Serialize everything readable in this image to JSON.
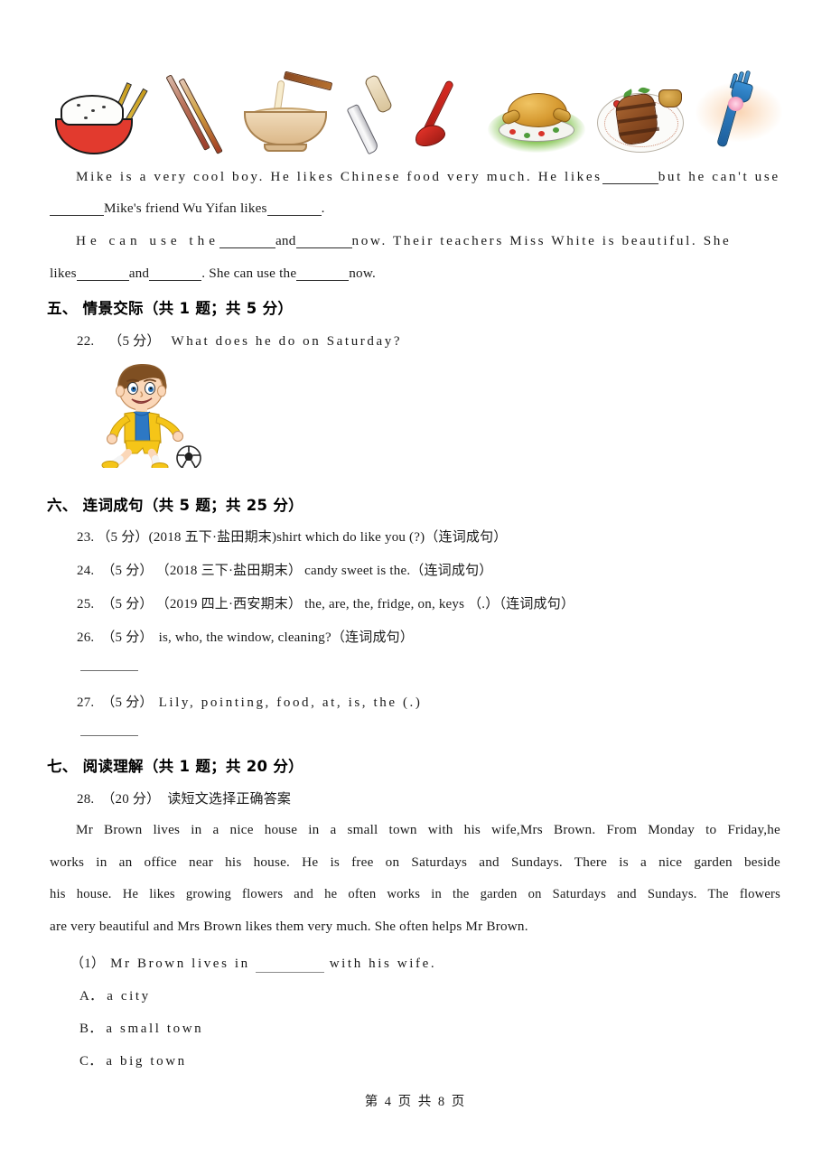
{
  "document": {
    "page_footer": "第 4 页 共 8 页",
    "page_number": 4,
    "total_pages": 8
  },
  "top_images": [
    {
      "name": "rice-bowl-with-chopsticks",
      "label": "rice bowl with chopsticks"
    },
    {
      "name": "chopsticks",
      "label": "chopsticks"
    },
    {
      "name": "noodle-bowl",
      "label": "noodle bowl with chopsticks"
    },
    {
      "name": "knife",
      "label": "knife"
    },
    {
      "name": "red-spoon",
      "label": "red spoon"
    },
    {
      "name": "roast-chicken",
      "label": "roast chicken on plate"
    },
    {
      "name": "steak-plate",
      "label": "steak on plate"
    },
    {
      "name": "blue-fork",
      "label": "blue fork"
    }
  ],
  "cloze": {
    "line1": "Mike is a very cool boy. He likes Chinese food very much. He likes",
    "line1_tail": "but he can't use",
    "line2_mid": "Mike's friend Wu Yifan likes",
    "line2_end": ".",
    "line3_a": "He can use the",
    "line3_and": "and",
    "line3_b": "now. Their teachers Miss White is beautiful. She",
    "line4_a": "likes",
    "line4_and": "and",
    "line4_b": ". She can use the",
    "line4_c": "now."
  },
  "sections": [
    {
      "name": "situational-communication",
      "heading": "五、 情景交际（共 1 题；共 5 分）",
      "questions": [
        {
          "number": "22.",
          "score": "（5 分）",
          "text": "What does he do on Saturday?",
          "image": "boy-playing-soccer"
        }
      ]
    },
    {
      "name": "sentence-making",
      "heading": "六、 连词成句（共 5 题；共 25 分）",
      "questions": [
        {
          "number": "23.",
          "score": "（5 分）",
          "source": "(2018 五下·盐田期末)",
          "text": "shirt        which       do       like       you       (?)（连词成句）"
        },
        {
          "number": "24.",
          "score": "（5 分）",
          "source": "（2018 三下·盐田期末）",
          "text": "candy       sweet      is      the.（连词成句）"
        },
        {
          "number": "25.",
          "score": "（5 分）",
          "source": "（2019 四上·西安期末）",
          "text": "the, are, the, fridge, on, keys （.）（连词成句）"
        },
        {
          "number": "26.",
          "score": "（5 分）",
          "source": "",
          "text": "is, who, the window, cleaning?（连词成句）"
        },
        {
          "number": "27.",
          "score": "（5 分）",
          "source": "",
          "text": "Lily, pointing, food, at, is, the (.)"
        }
      ]
    },
    {
      "name": "reading-comprehension",
      "heading": "七、 阅读理解（共 1 题；共 20 分）",
      "questions": [
        {
          "number": "28.",
          "score": "（20 分）",
          "text": "读短文选择正确答案"
        }
      ],
      "passage": [
        "Mr Brown lives in a nice house in a small town with his wife,Mrs Brown. From Monday to Friday,he",
        "works in an office near his house. He is free on Saturdays and Sundays. There is a nice garden beside",
        "his house. He likes growing flowers and he often works in the garden on Saturdays and Sundays. The flowers",
        "are very beautiful and Mrs Brown likes them very much. She often helps Mr Brown."
      ],
      "sub_questions": [
        {
          "number": "（1）",
          "stem_before": "Mr Brown lives in",
          "stem_after": "with his wife.",
          "options": [
            {
              "letter": "A．",
              "text": "a city"
            },
            {
              "letter": "B．",
              "text": "a small town"
            },
            {
              "letter": "C．",
              "text": "a big town"
            }
          ]
        }
      ]
    }
  ],
  "colors": {
    "text": "#1a1a1a",
    "rule": "#6d6d6d",
    "background": "#ffffff"
  }
}
